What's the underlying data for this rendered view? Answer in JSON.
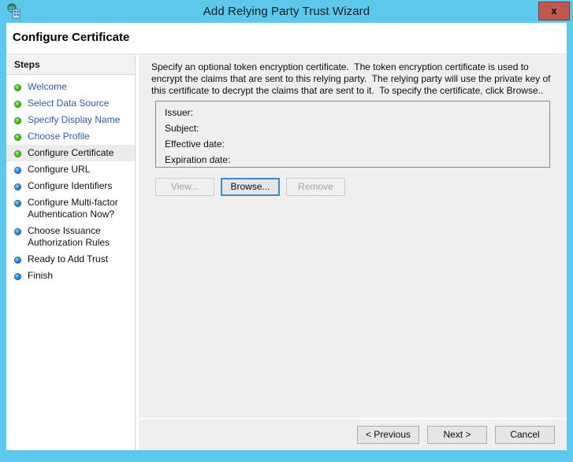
{
  "window": {
    "title": "Add Relying Party Trust Wizard",
    "app_icon": "adfs-wizard-icon",
    "close_label": "x",
    "accent_color": "#5bc8ec",
    "close_color": "#c0584f"
  },
  "page": {
    "heading": "Configure Certificate"
  },
  "sidebar": {
    "header": "Steps",
    "items": [
      {
        "label": "Welcome",
        "state": "done",
        "current": false
      },
      {
        "label": "Select Data Source",
        "state": "done",
        "current": false
      },
      {
        "label": "Specify Display Name",
        "state": "done",
        "current": false
      },
      {
        "label": "Choose Profile",
        "state": "done",
        "current": false
      },
      {
        "label": "Configure Certificate",
        "state": "done",
        "current": true
      },
      {
        "label": "Configure URL",
        "state": "pending",
        "current": false
      },
      {
        "label": "Configure Identifiers",
        "state": "pending",
        "current": false
      },
      {
        "label": "Configure Multi-factor\nAuthentication Now?",
        "state": "pending",
        "current": false
      },
      {
        "label": "Choose Issuance\nAuthorization Rules",
        "state": "pending",
        "current": false
      },
      {
        "label": "Ready to Add Trust",
        "state": "pending",
        "current": false
      },
      {
        "label": "Finish",
        "state": "pending",
        "current": false
      }
    ]
  },
  "content": {
    "intro": "Specify an optional token encryption certificate.  The token encryption certificate is used to encrypt the claims that are sent to this relying party.  The relying party will use the private key of this certificate to decrypt the claims that are sent to it.  To specify the certificate, click Browse..",
    "certificate": {
      "issuer_label": "Issuer:",
      "issuer_value": "",
      "subject_label": "Subject:",
      "subject_value": "",
      "effective_date_label": "Effective date:",
      "effective_date_value": "",
      "expiration_date_label": "Expiration date:",
      "expiration_date_value": ""
    },
    "actions": {
      "view": "View...",
      "browse": "Browse...",
      "remove": "Remove"
    }
  },
  "footer": {
    "previous": "< Previous",
    "next": "Next >",
    "cancel": "Cancel"
  }
}
